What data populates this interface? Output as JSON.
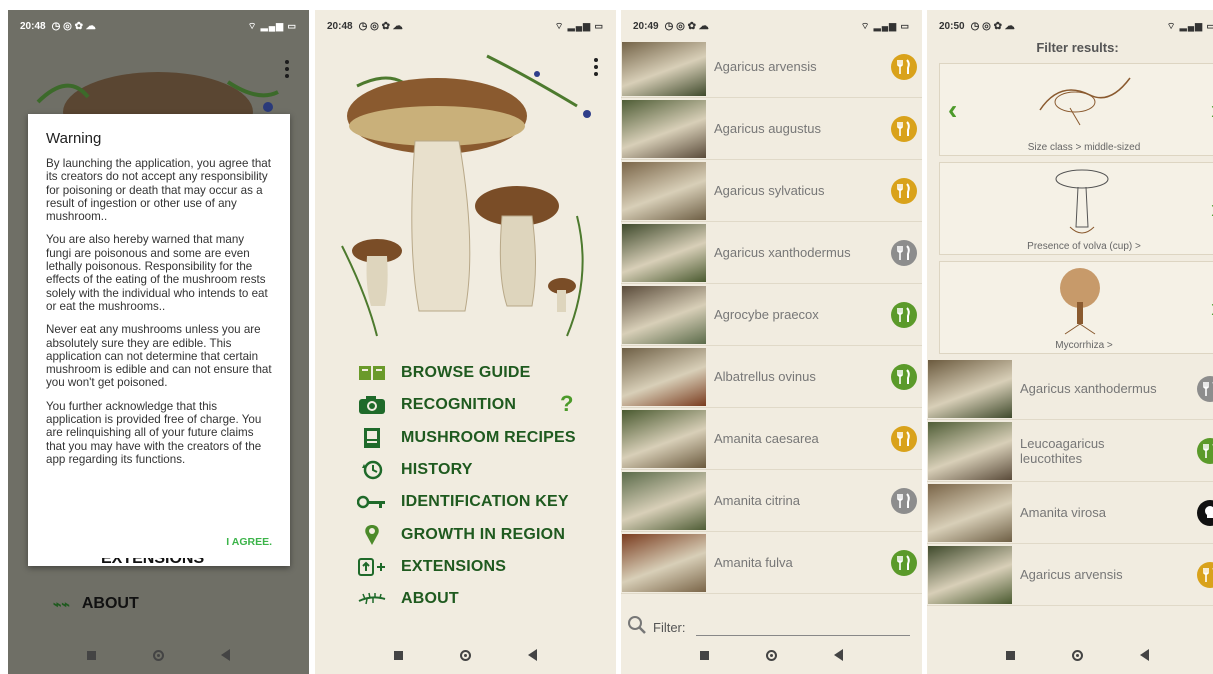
{
  "status": {
    "times": [
      "20:48",
      "20:48",
      "20:49",
      "20:50"
    ],
    "icons_left": "alarm-icon whatsapp-icon settings-icon cloud-icon",
    "icons_right": "wifi-icon signal-icon battery-icon",
    "battery": "51"
  },
  "screen1": {
    "dialog": {
      "title": "Warning",
      "paragraphs": [
        "By launching the application, you agree that its creators do not accept any responsibility for poisoning or death that may occur as a result of ingestion or other use of any mushroom..",
        "You are also hereby warned that many fungi are poisonous and some are even lethally poisonous. Responsibility for the effects of the eating of the mushroom rests solely with the individual who intends to eat or eat the mushrooms..",
        "Never eat any mushrooms unless you are absolutely sure they are edible. This application can not determine that certain mushroom is edible and can not ensure that you won't get poisoned.",
        "You further acknowledge that this application is provided free of charge. You are relinquishing all of your future claims that you may have with the creators of the app regarding its functions."
      ],
      "agree": "I AGREE."
    },
    "visible_menu": [
      "EXTENSIONS",
      "ABOUT"
    ]
  },
  "screen2": {
    "menu": [
      {
        "label": "BROWSE GUIDE",
        "icon": "book-icon"
      },
      {
        "label": "RECOGNITION",
        "icon": "camera-icon"
      },
      {
        "label": "MUSHROOM RECIPES",
        "icon": "recipe-book-icon"
      },
      {
        "label": "HISTORY",
        "icon": "history-icon"
      },
      {
        "label": "IDENTIFICATION KEY",
        "icon": "key-icon"
      },
      {
        "label": "GROWTH IN REGION",
        "icon": "location-pin-icon"
      },
      {
        "label": "EXTENSIONS",
        "icon": "extensions-icon"
      },
      {
        "label": "ABOUT",
        "icon": "fern-icon"
      }
    ],
    "help": "?"
  },
  "screen3": {
    "list": [
      {
        "name": "Agaricus arvensis",
        "edibility": "choice"
      },
      {
        "name": "Agaricus augustus",
        "edibility": "choice"
      },
      {
        "name": "Agaricus sylvaticus",
        "edibility": "choice"
      },
      {
        "name": "Agaricus xanthodermus",
        "edibility": "inedible"
      },
      {
        "name": "Agrocybe praecox",
        "edibility": "edible"
      },
      {
        "name": "Albatrellus ovinus",
        "edibility": "edible"
      },
      {
        "name": "Amanita caesarea",
        "edibility": "choice"
      },
      {
        "name": "Amanita citrina",
        "edibility": "inedible"
      },
      {
        "name": "Amanita fulva",
        "edibility": "edible"
      }
    ],
    "filter_label": "Filter:"
  },
  "screen4": {
    "title": "Filter results:",
    "cards": [
      "Size class > middle-sized",
      "Presence of volva (cup) >",
      "Mycorrhiza >"
    ],
    "list": [
      {
        "name": "Agaricus xanthodermus",
        "edibility": "inedible"
      },
      {
        "name": "Leucoagaricus leucothites",
        "edibility": "edible"
      },
      {
        "name": "Amanita virosa",
        "edibility": "poisonous"
      },
      {
        "name": "Agaricus arvensis",
        "edibility": "choice"
      }
    ]
  },
  "colors": {
    "choice": "#d9a21b",
    "edible": "#5b9a2a",
    "inedible": "#8d8d8d",
    "poisonous": "#111111",
    "menu_text": "#1f5a1f",
    "background": "#f1ece0"
  }
}
